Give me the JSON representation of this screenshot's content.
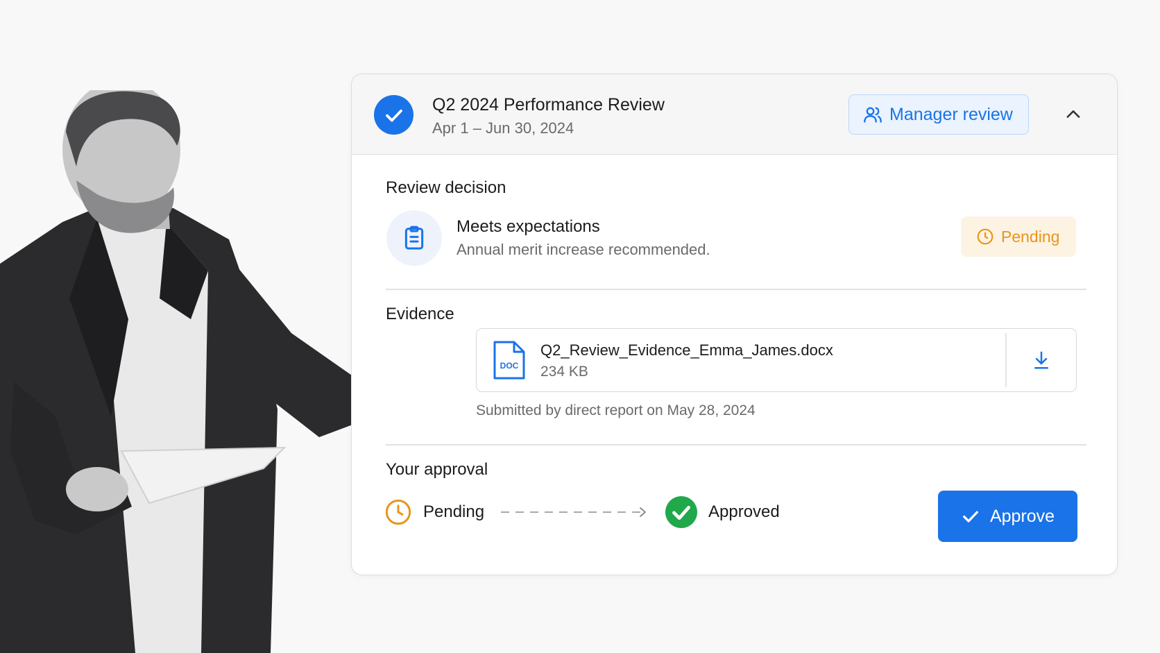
{
  "header": {
    "title": "Q2 2024 Performance Review",
    "dates": "Apr 1 – Jun 30, 2024",
    "role_badge": "Manager review"
  },
  "review_decision": {
    "section_title": "Review decision",
    "outcome": "Meets expectations",
    "note": "Annual merit increase recommended.",
    "status": "Pending"
  },
  "evidence": {
    "section_title": "Evidence",
    "file_type": "DOC",
    "file_name": "Q2_Review_Evidence_Emma_James.docx",
    "file_size": "234 KB",
    "submitted_note": "Submitted by direct report on May 28, 2024"
  },
  "approval": {
    "section_title": "Your approval",
    "from_state": "Pending",
    "to_state": "Approved",
    "approve_label": "Approve"
  },
  "colors": {
    "accent": "#1a73e8",
    "pending": "#e8951b",
    "approved": "#21a84a"
  }
}
